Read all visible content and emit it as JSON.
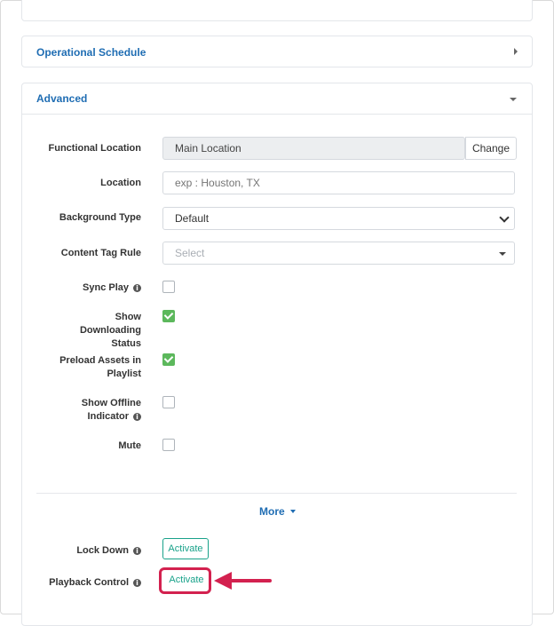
{
  "panels": {
    "operational_schedule": {
      "title": "Operational Schedule"
    },
    "advanced": {
      "title": "Advanced"
    }
  },
  "fields": {
    "functional_location": {
      "label": "Functional Location",
      "value": "Main Location",
      "button": "Change"
    },
    "location": {
      "label": "Location",
      "placeholder": "exp : Houston, TX",
      "value": ""
    },
    "background_type": {
      "label": "Background Type",
      "value": "Default"
    },
    "content_tag_rule": {
      "label": "Content Tag Rule",
      "placeholder": "Select"
    },
    "sync_play": {
      "label": "Sync Play",
      "checked": false
    },
    "show_downloading_status": {
      "label": "Show Downloading Status",
      "checked": true
    },
    "preload_assets": {
      "label": "Preload Assets in Playlist",
      "checked": true
    },
    "show_offline_indicator": {
      "label": "Show Offline Indicator",
      "checked": false
    },
    "mute": {
      "label": "Mute",
      "checked": false
    }
  },
  "more": {
    "label": "More"
  },
  "lock_down": {
    "label": "Lock Down",
    "button": "Activate"
  },
  "playback_control": {
    "label": "Playback Control",
    "button": "Activate"
  },
  "info_glyph": "i",
  "colors": {
    "link": "#1f6db3",
    "accent": "#19a28a",
    "check": "#5cb85c",
    "annotation": "#d3214f"
  }
}
